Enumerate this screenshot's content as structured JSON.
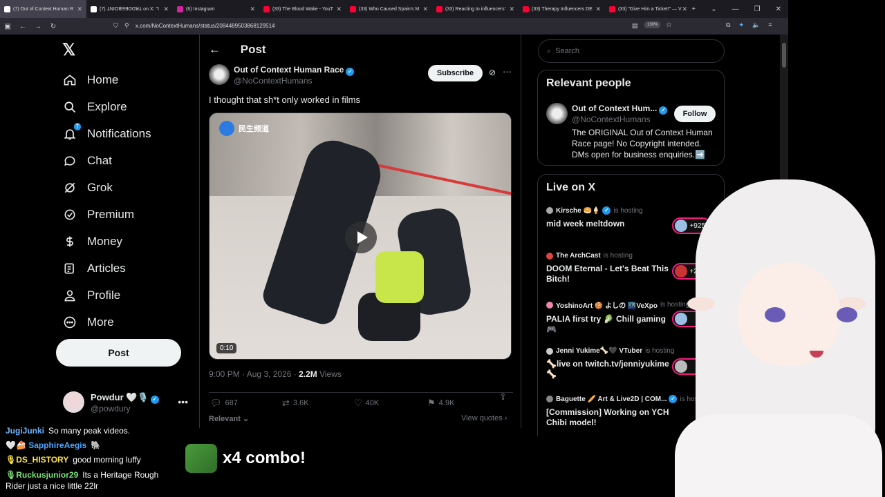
{
  "browser": {
    "tabs": [
      {
        "label": "(7) Out of Context Human R",
        "color": "#e7e9ea",
        "active": true
      },
      {
        "label": "(7) ꓕNIOꓭƎƎꓷꓷꓤꓕ on X: \"I",
        "color": "#e7e9ea",
        "active": false
      },
      {
        "label": "(6) Instagram",
        "color": "#d6249f",
        "active": false
      },
      {
        "label": "(33) The Blood Wake - YouT",
        "color": "#ff0033",
        "active": false
      },
      {
        "label": "(33) Who Caused Spain's M",
        "color": "#ff0033",
        "active": false
      },
      {
        "label": "(33) Reacting to influencers'",
        "color": "#ff0033",
        "active": false
      },
      {
        "label": "(33) Therapy Influencers DE",
        "color": "#ff0033",
        "active": false
      },
      {
        "label": "(33) \"Give Him a Ticket!\" — V",
        "color": "#ff0033",
        "active": false
      }
    ],
    "url": "x.com/NoContextHumans/status/2084489503868129514",
    "zoom": "130%"
  },
  "sidebar": {
    "logo": "𝕏",
    "items": [
      {
        "label": "Home",
        "icon": "home-icon"
      },
      {
        "label": "Explore",
        "icon": "search-icon"
      },
      {
        "label": "Notifications",
        "icon": "bell-icon",
        "badge": "7"
      },
      {
        "label": "Chat",
        "icon": "chat-icon"
      },
      {
        "label": "Grok",
        "icon": "grok-icon"
      },
      {
        "label": "Premium",
        "icon": "premium-icon"
      },
      {
        "label": "Money",
        "icon": "money-icon"
      },
      {
        "label": "Articles",
        "icon": "articles-icon"
      },
      {
        "label": "Profile",
        "icon": "profile-icon"
      },
      {
        "label": "More",
        "icon": "more-icon"
      }
    ],
    "post_label": "Post",
    "account": {
      "name": "Powdur 🤍🎙️",
      "handle": "@powdury"
    }
  },
  "post": {
    "header": "Post",
    "author_name": "Out of Context Human Race",
    "author_handle": "@NoContextHumans",
    "subscribe_label": "Subscribe",
    "text": "I thought that sh*t only worked in films",
    "video_watermark": "民生频道",
    "duration": "0:10",
    "time": "9:00 PM · Aug 3, 2026 · ",
    "views_count": "2.2M",
    "views_label": " Views",
    "replies": "687",
    "reposts": "3.6K",
    "likes": "40K",
    "bookmarks": "4.9K",
    "relevant": "Relevant",
    "view_quotes": "View quotes"
  },
  "right": {
    "search_placeholder": "Search",
    "relevant_title": "Relevant people",
    "person": {
      "name": "Out of Context Hum...",
      "handle": "@NoContextHumans",
      "follow": "Follow",
      "bio": "The ORIGINAL Out of Context Human Race page! No Copyright intended. DMs open for business enquiries.➡️"
    },
    "live_title": "Live on X",
    "live": [
      {
        "host": "Kirsche 🥯🍦",
        "status": "is hosting",
        "title": "mid week meltdown",
        "count": "+925"
      },
      {
        "host": "The ArchCast",
        "status": "is hosting",
        "title": "DOOM Eternal - Let's Beat This Bitch!",
        "count": "+284"
      },
      {
        "host": "YoshinoArt 🍪 よしの 🌃VeXpo",
        "status": "is hosting",
        "title": "PALIA first try 🥬 Chill gaming 🎮",
        "count": "+1"
      },
      {
        "host": "Jenni Yukime🦴🖤 VTuber",
        "status": "is hosting",
        "title": "🦴live on twitch.tv/jenniyukime 🦴",
        "count": "+5"
      },
      {
        "host": "Baguette 🥖 Art & Live2D | COM...",
        "status": "is hosting",
        "title": "[Commission] Working on YCH Chibi model!",
        "count": ""
      }
    ]
  },
  "stream_chat": [
    {
      "user": "JugiJunki",
      "color": "#6fb3ff",
      "msg": "So many peak videos."
    },
    {
      "user": "🤍🍰 SapphireAegis",
      "color": "#4aa6ff",
      "msg": "🐘"
    },
    {
      "user": "🎙DS_HISTORY",
      "color": "#ffe44a",
      "msg": "good morning luffy"
    },
    {
      "user": "🎙Ruckusjunior29",
      "color": "#7be07b",
      "msg": "Its a Heritage Rough Rider just a nice little 22lr"
    }
  ],
  "combo": "x4 combo!"
}
